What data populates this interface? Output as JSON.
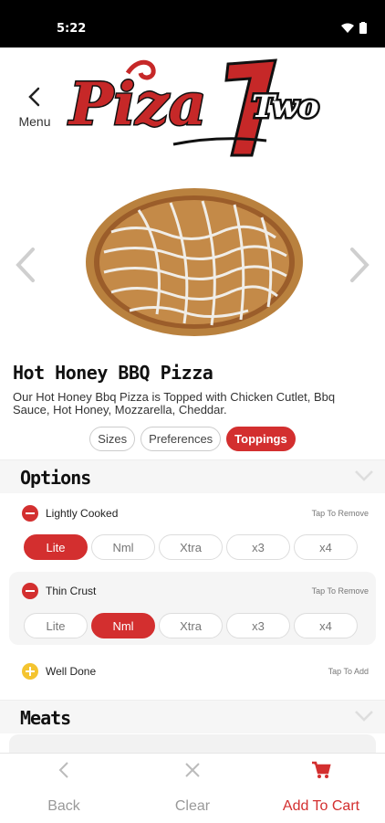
{
  "status": {
    "time": "5:22"
  },
  "header": {
    "back_label": "Menu",
    "logo_text": "Pizza 1 Two"
  },
  "product": {
    "title": "Hot Honey BBQ Pizza",
    "description": "Our Hot Honey Bbq Pizza is Topped with Chicken Cutlet, Bbq Sauce, Hot Honey, Mozzarella, Cheddar."
  },
  "tabs": [
    {
      "label": "Sizes"
    },
    {
      "label": "Preferences"
    },
    {
      "label": "Toppings"
    }
  ],
  "sections": [
    {
      "title": "Options"
    },
    {
      "title": "Meats"
    }
  ],
  "options": [
    {
      "name": "Lightly Cooked",
      "hint": "Tap To Remove",
      "levels": [
        "Lite",
        "Nml",
        "Xtra",
        "x3",
        "x4"
      ],
      "selected": "Lite"
    },
    {
      "name": "Thin Crust",
      "hint": "Tap To Remove",
      "levels": [
        "Lite",
        "Nml",
        "Xtra",
        "x3",
        "x4"
      ],
      "selected": "Nml"
    },
    {
      "name": "Well Done",
      "hint": "Tap To Add"
    }
  ],
  "bottom": {
    "back_label": "Back",
    "clear_label": "Clear",
    "cart_label": "Add To Cart"
  },
  "colors": {
    "accent": "#d32f2f",
    "add": "#f4c430"
  }
}
